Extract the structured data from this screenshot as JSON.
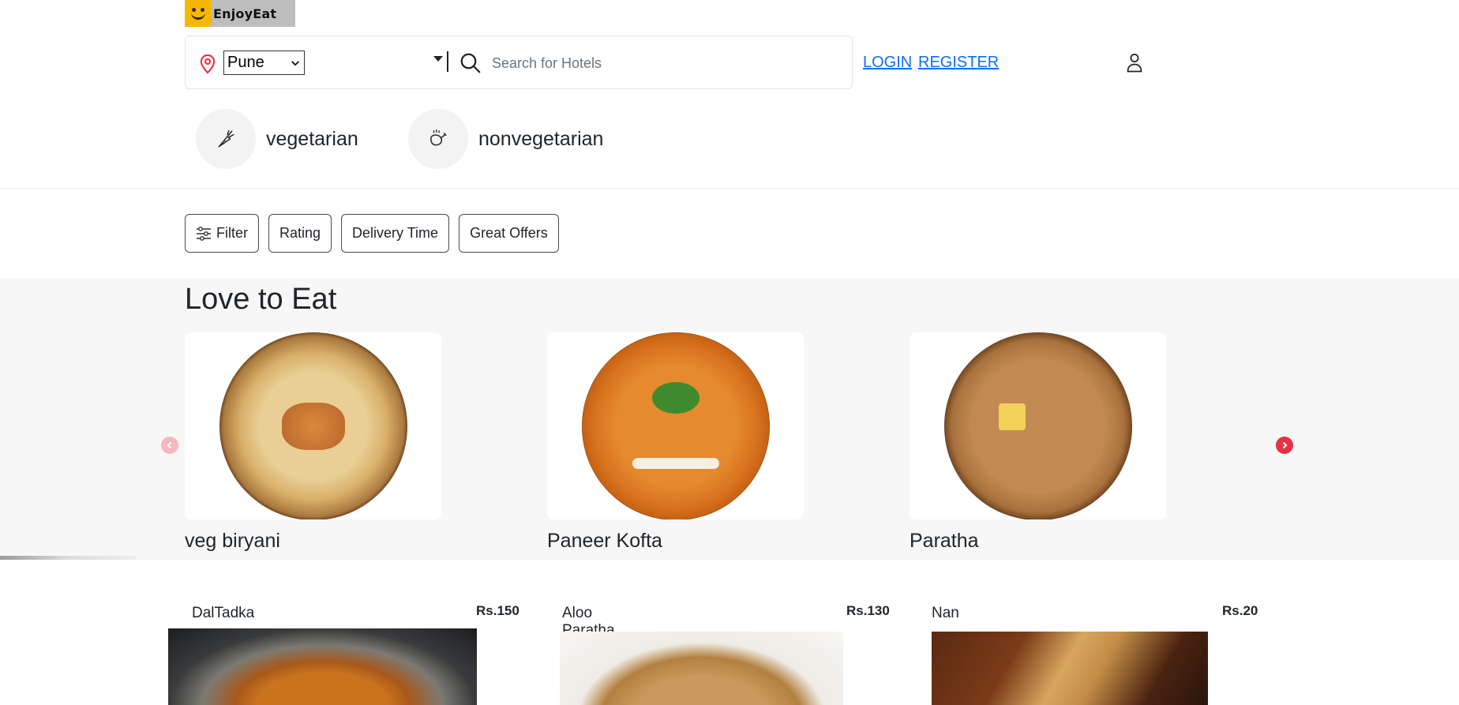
{
  "header": {
    "logo_text": "EnjoyEat",
    "location": {
      "selected": "Pune"
    },
    "search": {
      "placeholder": "Search for Hotels"
    },
    "login_label": "LOGIN",
    "register_label": "REGISTER"
  },
  "categories": [
    {
      "label": "vegetarian",
      "icon": "carrot-icon"
    },
    {
      "label": "nonvegetarian",
      "icon": "chicken-leg-icon"
    }
  ],
  "filters": [
    {
      "label": "Filter",
      "icon": "sliders-icon"
    },
    {
      "label": "Rating"
    },
    {
      "label": "Delivery Time"
    },
    {
      "label": "Great Offers"
    }
  ],
  "love_section": {
    "title": "Love to Eat",
    "items": [
      {
        "label": "veg biryani"
      },
      {
        "label": "Paneer Kofta"
      },
      {
        "label": "Paratha"
      }
    ]
  },
  "menu": [
    {
      "name": "DalTadka",
      "price": "Rs.150"
    },
    {
      "name": "Aloo Paratha",
      "price": "Rs.130"
    },
    {
      "name": "Nan",
      "price": "Rs.20"
    }
  ],
  "colors": {
    "link": "#0d6efd",
    "arrow": "#e53244",
    "pin": "#e53244",
    "section_bg": "#f7f7f7"
  }
}
